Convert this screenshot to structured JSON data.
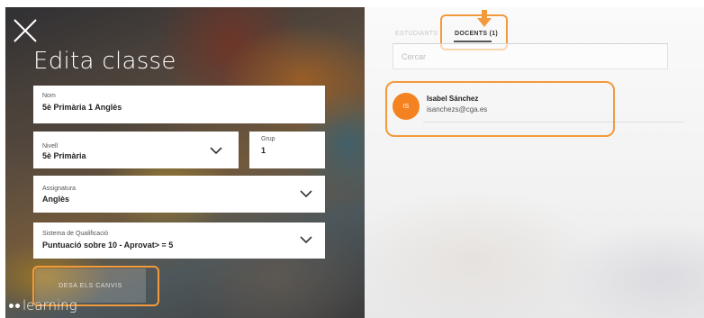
{
  "left_panel": {
    "title": "Edita classe",
    "fields": {
      "nom": {
        "label": "Nom",
        "value": "5è Primària 1 Anglès"
      },
      "nivell": {
        "label": "Nivell",
        "value": "5è Primària"
      },
      "grup": {
        "label": "Grup",
        "value": "1"
      },
      "assignatura": {
        "label": "Assignatura",
        "value": "Anglès"
      },
      "qualificacio": {
        "label": "Sistema de Qualificació",
        "value": "Puntuació sobre 10 - Aprovat> = 5"
      }
    },
    "save_button": "DESA ELS CANVIS",
    "logo_text": "learning"
  },
  "right_panel": {
    "tabs": [
      {
        "label": "ESTUDIANTS",
        "active": false
      },
      {
        "label": "DOCENTS (1)",
        "active": true
      }
    ],
    "search": {
      "placeholder": "Cercar"
    },
    "teachers": [
      {
        "initials": "IS",
        "name": "Isabel Sánchez",
        "email": "isanchezs@cga.es"
      }
    ]
  },
  "colors": {
    "highlight": "#f39a3c",
    "avatar": "#f58220"
  },
  "icons": [
    "close-icon",
    "chevron-down-icon",
    "down-arrow-icon"
  ]
}
